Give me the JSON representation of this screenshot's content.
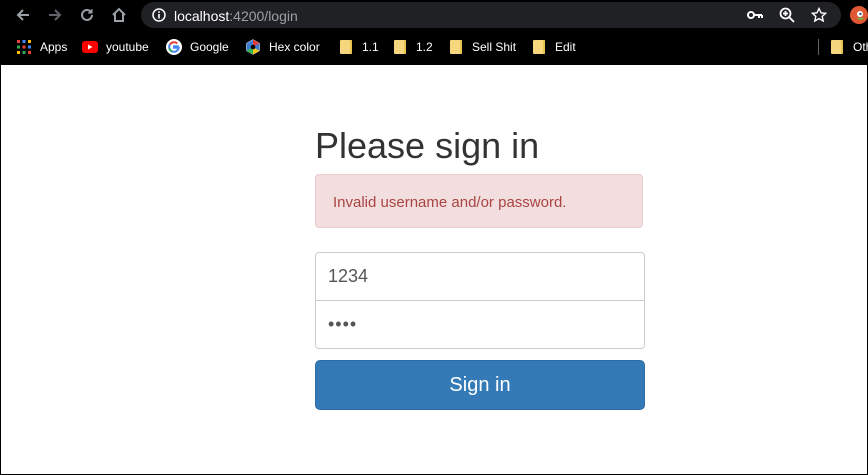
{
  "browser": {
    "url_host": "localhost",
    "url_path": ":4200/login",
    "bookmarks": [
      {
        "label": "Apps",
        "icon": "apps-grid-icon"
      },
      {
        "label": "youtube",
        "icon": "youtube-icon"
      },
      {
        "label": "Google",
        "icon": "google-icon"
      },
      {
        "label": "Hex color",
        "icon": "hex-color-icon"
      },
      {
        "label": "1.1",
        "icon": "folder-icon"
      },
      {
        "label": "1.2",
        "icon": "folder-icon"
      },
      {
        "label": "Sell Shit",
        "icon": "folder-icon"
      },
      {
        "label": "Edit",
        "icon": "folder-icon"
      },
      {
        "label": "Oth",
        "icon": "folder-icon"
      }
    ]
  },
  "login": {
    "title": "Please sign in",
    "error": "Invalid username and/or password.",
    "username_value": "1234",
    "password_value": "1234",
    "submit_label": "Sign in"
  },
  "colors": {
    "primary": "#337ab7",
    "alert_bg": "#f2dede",
    "alert_text": "#a94442"
  }
}
